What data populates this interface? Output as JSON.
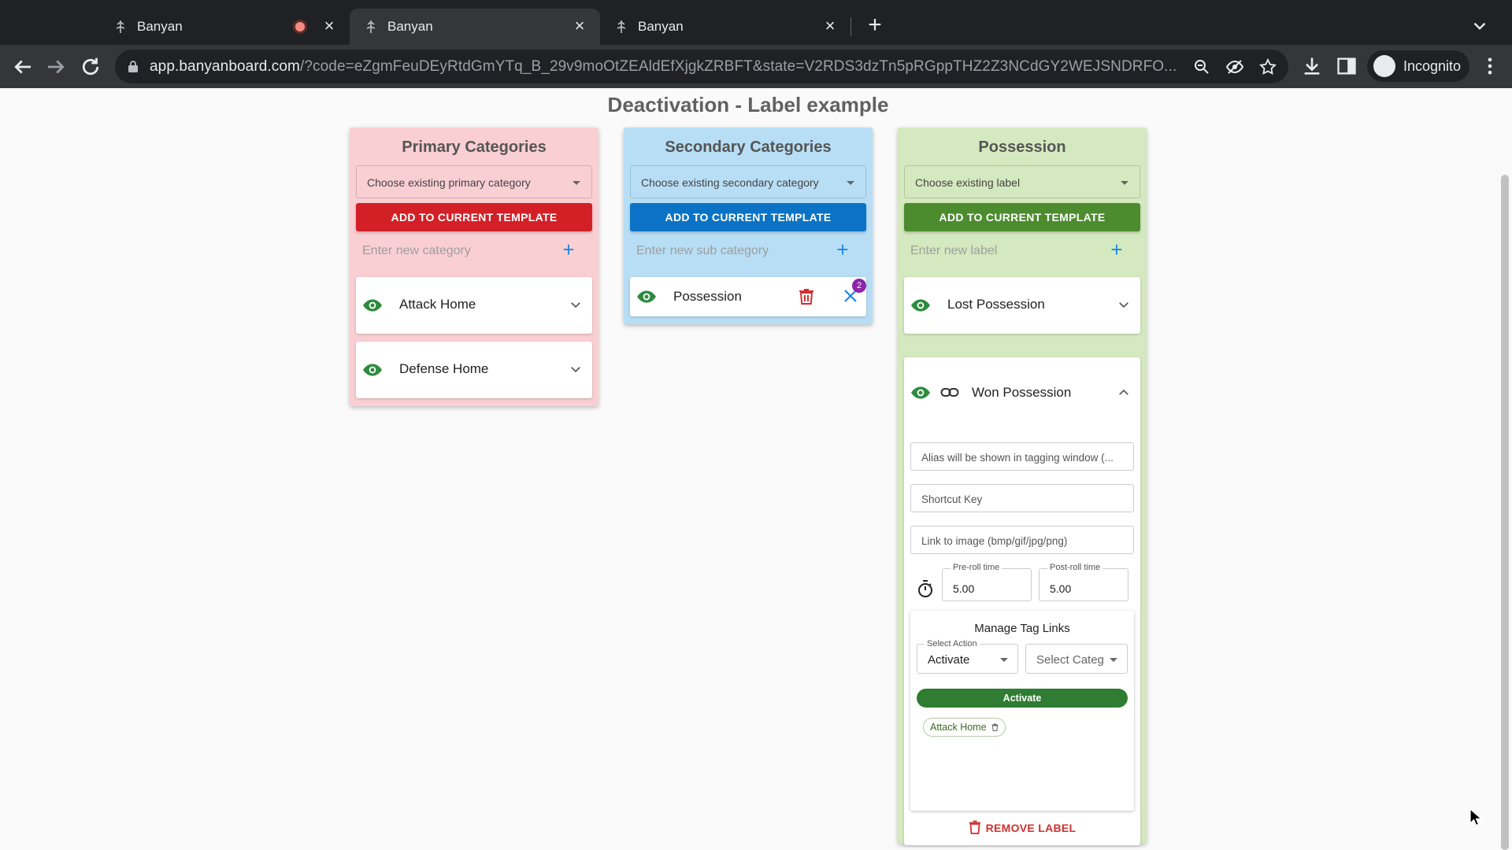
{
  "browser": {
    "tabs": [
      {
        "title": "Banyan",
        "recording": true,
        "active": false
      },
      {
        "title": "Banyan",
        "recording": false,
        "active": true
      },
      {
        "title": "Banyan",
        "recording": false,
        "active": false
      }
    ],
    "url_domain": "app.banyanboard.com",
    "url_rest": "/?code=eZgmFeuDEyRtdGmYTq_B_29v9moOtZEAldEfXjgkZRBFT&state=V2RDS3dzTn5pRGppTHZ2Z3NCdGY2WEJSNDRFO...",
    "profile_label": "Incognito"
  },
  "page": {
    "title": "Deactivation - Label example"
  },
  "colors": {
    "primary_bg": "#f9cfd3",
    "primary_btn": "#d32027",
    "secondary_bg": "#b7def5",
    "secondary_btn": "#0b73c6",
    "possession_bg": "#d4e9bf",
    "possession_btn": "#4c8c2e",
    "eye_green": "#2e8b3e",
    "link_blue": "#1e88e5",
    "remove_red": "#d32f2f"
  },
  "primary": {
    "title": "Primary Categories",
    "select_placeholder": "Choose existing primary category",
    "add_label": "ADD TO CURRENT TEMPLATE",
    "new_placeholder": "Enter new category",
    "items": [
      "Attack Home",
      "Defense Home"
    ]
  },
  "secondary": {
    "title": "Secondary Categories",
    "select_placeholder": "Choose existing secondary category",
    "add_label": "ADD TO CURRENT TEMPLATE",
    "new_placeholder": "Enter new sub category",
    "item": {
      "label": "Possession",
      "badge": "2"
    }
  },
  "possession": {
    "title": "Possession",
    "select_placeholder": "Choose existing label",
    "add_label": "ADD TO CURRENT TEMPLATE",
    "new_placeholder": "Enter new label",
    "lost_label": "Lost Possession",
    "won": {
      "label": "Won Possession",
      "alias_placeholder": "Alias will be shown in tagging window (...",
      "shortcut_placeholder": "Shortcut Key",
      "image_placeholder": "Link to image (bmp/gif/jpg/png)",
      "preroll_label": "Pre-roll time",
      "preroll_value": "5.00",
      "postroll_label": "Post-roll time",
      "postroll_value": "5.00",
      "tag_links": {
        "title": "Manage Tag Links",
        "action_label": "Select Action",
        "action_value": "Activate",
        "category_placeholder": "Select Categ",
        "button_label": "Activate",
        "chip": "Attack Home"
      },
      "remove_label": "REMOVE LABEL"
    }
  }
}
